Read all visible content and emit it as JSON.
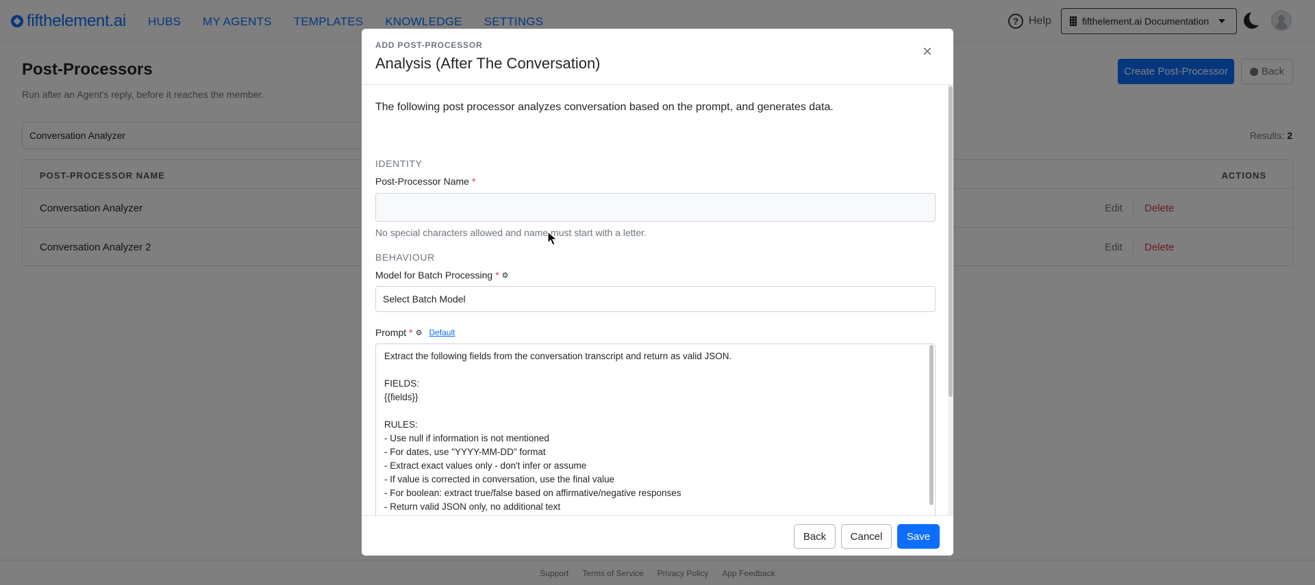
{
  "nav": {
    "brand": "fifthelement.ai",
    "links": [
      "HUBS",
      "MY AGENTS",
      "TEMPLATES",
      "KNOWLEDGE",
      "SETTINGS"
    ],
    "help": "Help",
    "workspace": "fifthelement.ai Documentation"
  },
  "page": {
    "title": "Post-Processors",
    "subtitle": "Run after an Agent's reply, before it reaches the member.",
    "create_button": "Create Post-Processor",
    "back_button": "Back",
    "filter_value": "Conversation Analyzer",
    "results_label": "Results:",
    "results_count": "2"
  },
  "table": {
    "columns": [
      "POST-PROCESSOR NAME",
      "ACTIONS"
    ],
    "rows": [
      {
        "name": "Conversation Analyzer",
        "edit": "Edit",
        "delete": "Delete"
      },
      {
        "name": "Conversation Analyzer 2",
        "edit": "Edit",
        "delete": "Delete"
      }
    ]
  },
  "footer": {
    "links": [
      "Support",
      "Terms of Service",
      "Privacy Policy",
      "App Feedback"
    ]
  },
  "modal": {
    "eyebrow": "ADD POST-PROCESSOR",
    "title": "Analysis (After The Conversation)",
    "close": "×",
    "intro": "The following post processor analyzes conversation based on the prompt, and generates data.",
    "identity_heading": "IDENTITY",
    "name_label": "Post-Processor Name",
    "required_mark": "*",
    "name_value": "",
    "name_help": "No special characters allowed and name must start with a letter.",
    "behaviour_heading": "BEHAVIOUR",
    "model_label": "Model for Batch Processing",
    "model_value": "Select Batch Model",
    "prompt_label": "Prompt",
    "default_link": "Default",
    "prompt_text": "Extract the following fields from the conversation transcript and return as valid JSON.\n\nFIELDS:\n{{fields}}\n\nRULES:\n- Use null if information is not mentioned\n- For dates, use \"YYYY-MM-DD\" format\n- Extract exact values only - don't infer or assume\n- If value is corrected in conversation, use the final value\n- For boolean: extract true/false based on affirmative/negative responses\n- Return valid JSON only, no additional text\n\nOUTPUT (JSON only):",
    "buttons": {
      "back": "Back",
      "cancel": "Cancel",
      "save": "Save"
    }
  },
  "colors": {
    "accent": "#0d6efd",
    "danger": "#dc3545",
    "backdrop": "rgba(0,0,0,0.5)"
  },
  "icons": [
    "brand-icon",
    "help-icon",
    "building-icon",
    "moon-icon",
    "avatar",
    "back-circle-icon",
    "close-icon",
    "gear-icon",
    "mouse-cursor-icon"
  ]
}
